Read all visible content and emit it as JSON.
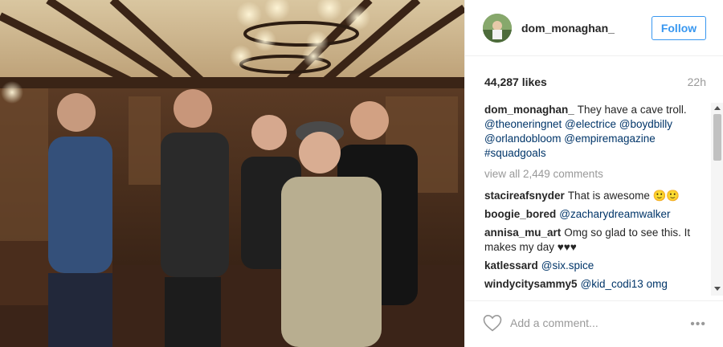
{
  "post": {
    "username": "dom_monaghan_",
    "follow_label": "Follow",
    "likes": "44,287 likes",
    "time": "22h",
    "caption": {
      "user": "dom_monaghan_",
      "text": "They have a cave troll.",
      "tags": [
        "@theoneringnet",
        "@electrice",
        "@boydbilly",
        "@orlandobloom",
        "@empiremagazine",
        "#squadgoals"
      ]
    },
    "view_all": "view all 2,449 comments",
    "comments": [
      {
        "user": "stacireafsnyder",
        "text": "That is awesome 🙂🙂"
      },
      {
        "user": "boogie_bored",
        "text": "@zacharydreamwalker"
      },
      {
        "user": "annisa_mu_art",
        "text": "Omg so glad to see this. It makes my day ♥♥♥"
      },
      {
        "user": "katlessard",
        "text": "@six.spice"
      },
      {
        "user": "windycitysammy5",
        "text": "@kid_codi13 omg"
      }
    ],
    "add_comment_placeholder": "Add a comment...",
    "more_label": "•••"
  },
  "icons": {
    "heart": "heart-icon",
    "more": "more-options-icon",
    "scroll_up": "scroll-up-arrow-icon",
    "scroll_down": "scroll-down-arrow-icon"
  },
  "colors": {
    "accent": "#3897f0",
    "tag": "#003569",
    "muted": "#999999",
    "text": "#262626"
  }
}
